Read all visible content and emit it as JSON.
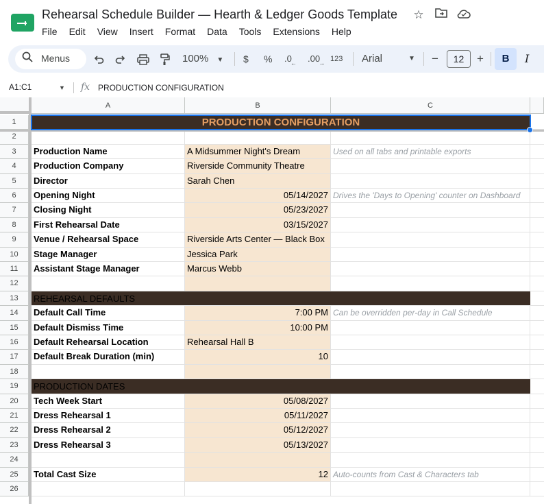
{
  "window": {
    "title": "Rehearsal Schedule Builder — Hearth & Ledger Goods Template",
    "menus": [
      "File",
      "Edit",
      "View",
      "Insert",
      "Format",
      "Data",
      "Tools",
      "Extensions",
      "Help"
    ]
  },
  "toolbar": {
    "search_label": "Menus",
    "zoom": "100%",
    "currency": "$",
    "percent": "%",
    "decrease_decimals": ".0",
    "increase_decimals": ".00",
    "number_format": "123",
    "font": "Arial",
    "font_size": "12",
    "minus": "−",
    "plus": "+",
    "bold": "B",
    "italic": "I"
  },
  "formula_bar": {
    "name_box": "A1:C1",
    "fx": "fx",
    "value": "PRODUCTION CONFIGURATION"
  },
  "columns": [
    "A",
    "B",
    "C"
  ],
  "rows": [
    {
      "n": "1",
      "kind": "title",
      "a": "PRODUCTION CONFIGURATION"
    },
    {
      "n": "2",
      "kind": "blank"
    },
    {
      "n": "3",
      "kind": "field",
      "a": "Production Name",
      "b": "A Midsummer Night's Dream",
      "align": "left",
      "c": "Used on all tabs and printable exports"
    },
    {
      "n": "4",
      "kind": "field",
      "a": "Production Company",
      "b": "Riverside Community Theatre",
      "align": "left",
      "c": ""
    },
    {
      "n": "5",
      "kind": "field",
      "a": "Director",
      "b": "Sarah Chen",
      "align": "left",
      "c": ""
    },
    {
      "n": "6",
      "kind": "field",
      "a": "Opening Night",
      "b": "05/14/2027",
      "align": "right",
      "c": "Drives the 'Days to Opening' counter on Dashboard"
    },
    {
      "n": "7",
      "kind": "field",
      "a": "Closing Night",
      "b": "05/23/2027",
      "align": "right",
      "c": ""
    },
    {
      "n": "8",
      "kind": "field",
      "a": "First Rehearsal Date",
      "b": "03/15/2027",
      "align": "right",
      "c": ""
    },
    {
      "n": "9",
      "kind": "field",
      "a": "Venue / Rehearsal Space",
      "b": "Riverside Arts Center — Black Box",
      "align": "left",
      "c": ""
    },
    {
      "n": "10",
      "kind": "field",
      "a": "Stage Manager",
      "b": "Jessica Park",
      "align": "left",
      "c": ""
    },
    {
      "n": "11",
      "kind": "field",
      "a": "Assistant Stage Manager",
      "b": "Marcus Webb",
      "align": "left",
      "c": ""
    },
    {
      "n": "12",
      "kind": "empty-field"
    },
    {
      "n": "13",
      "kind": "section",
      "a": "REHEARSAL DEFAULTS"
    },
    {
      "n": "14",
      "kind": "field",
      "a": "Default Call Time",
      "b": "7:00 PM",
      "align": "right",
      "c": "Can be overridden per-day in Call Schedule"
    },
    {
      "n": "15",
      "kind": "field",
      "a": "Default Dismiss Time",
      "b": "10:00 PM",
      "align": "right",
      "c": ""
    },
    {
      "n": "16",
      "kind": "field",
      "a": "Default Rehearsal Location",
      "b": "Rehearsal Hall B",
      "align": "left",
      "c": ""
    },
    {
      "n": "17",
      "kind": "field",
      "a": "Default Break Duration (min)",
      "b": "10",
      "align": "right",
      "c": ""
    },
    {
      "n": "18",
      "kind": "empty-field"
    },
    {
      "n": "19",
      "kind": "section",
      "a": "PRODUCTION DATES"
    },
    {
      "n": "20",
      "kind": "field",
      "a": "Tech Week Start",
      "b": "05/08/2027",
      "align": "right",
      "c": ""
    },
    {
      "n": "21",
      "kind": "field",
      "a": "Dress Rehearsal 1",
      "b": "05/11/2027",
      "align": "right",
      "c": ""
    },
    {
      "n": "22",
      "kind": "field",
      "a": "Dress Rehearsal 2",
      "b": "05/12/2027",
      "align": "right",
      "c": ""
    },
    {
      "n": "23",
      "kind": "field",
      "a": "Dress Rehearsal 3",
      "b": "05/13/2027",
      "align": "right",
      "c": ""
    },
    {
      "n": "24",
      "kind": "empty-field"
    },
    {
      "n": "25",
      "kind": "field",
      "a": "Total Cast Size",
      "b": "12",
      "align": "right",
      "c": "Auto-counts from Cast & Characters tab"
    },
    {
      "n": "26",
      "kind": "blank"
    }
  ],
  "colors": {
    "section_bg": "#3b2d24",
    "title_text": "#e59e62",
    "input_bg": "#f7e6d1",
    "note_text": "#9aa0a6",
    "selection": "#1a73e8"
  }
}
